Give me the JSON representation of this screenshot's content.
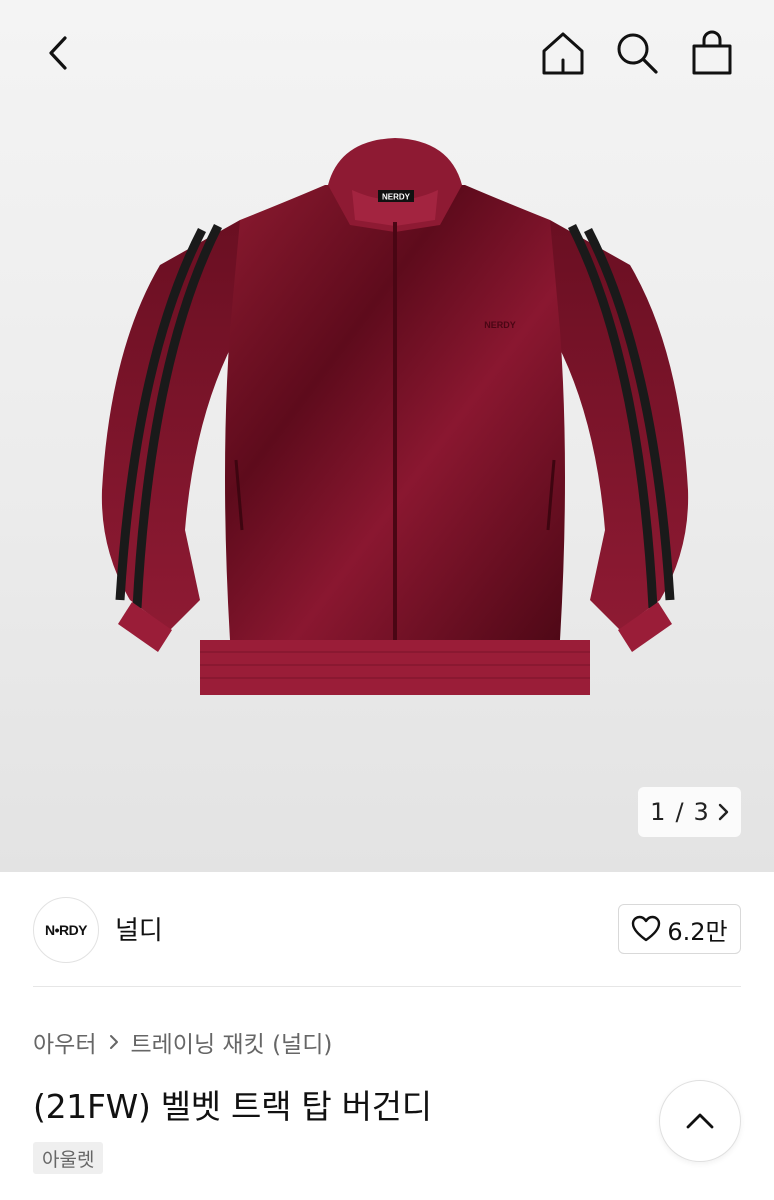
{
  "header": {
    "back_icon": "chevron-left-icon",
    "home_icon": "home-icon",
    "search_icon": "search-icon",
    "bag_icon": "shopping-bag-icon"
  },
  "gallery": {
    "current_page": "1",
    "separator": "/",
    "total_pages": "3",
    "product_logo_text": "NERDY"
  },
  "brand": {
    "logo_text": "N•RDY",
    "name": "널디",
    "like_count": "6.2만"
  },
  "breadcrumb": {
    "category": "아우터",
    "subcategory": "트레이닝 재킷 (널디)"
  },
  "product": {
    "title": "(21FW) 벨벳 트랙 탑 버건디",
    "tag": "아울렛"
  },
  "colors": {
    "jacket": "#7a1025",
    "stripe": "#1a1a1a",
    "background": "#efefef"
  }
}
